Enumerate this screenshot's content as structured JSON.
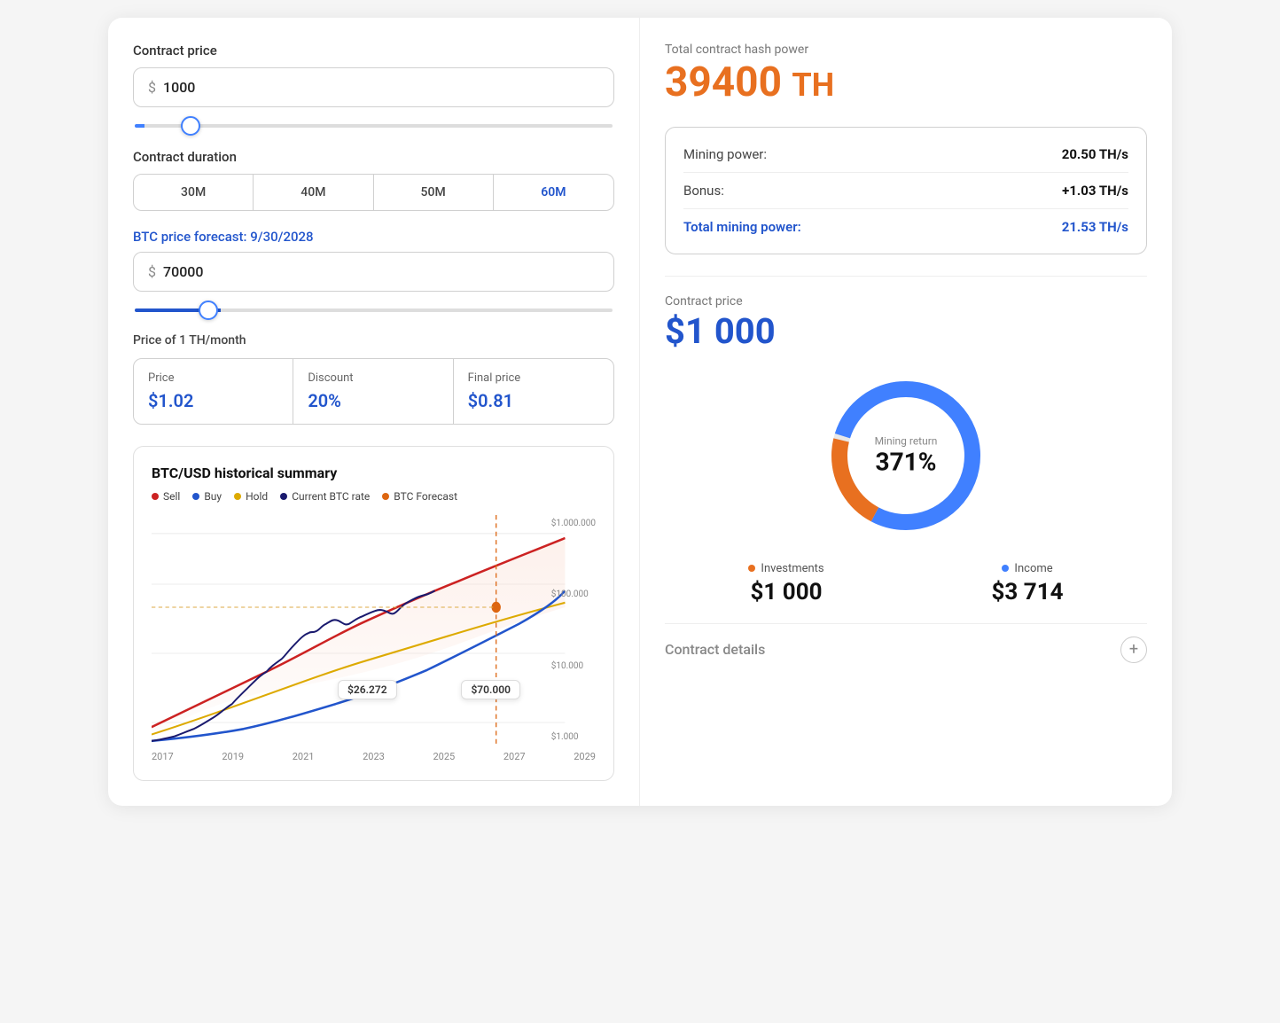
{
  "left": {
    "contract_price_label": "Contract price",
    "contract_price_currency": "$",
    "contract_price_value": "1000",
    "contract_duration_label": "Contract duration",
    "duration_tabs": [
      "30M",
      "40M",
      "50M",
      "60M"
    ],
    "active_tab_index": 3,
    "btc_forecast_label": "BTC price forecast:",
    "btc_forecast_date": "9/30/2028",
    "btc_price_currency": "$",
    "btc_price_value": "70000",
    "price_th_label": "Price of 1 TH/month",
    "price_cells": [
      {
        "label": "Price",
        "value": "$1.02"
      },
      {
        "label": "Discount",
        "value": "20%"
      },
      {
        "label": "Final price",
        "value": "$0.81"
      }
    ],
    "chart": {
      "title": "BTC/USD historical summary",
      "legend": [
        {
          "label": "Sell",
          "color": "#cc2222"
        },
        {
          "label": "Buy",
          "color": "#2255cc"
        },
        {
          "label": "Hold",
          "color": "#ddaa00"
        },
        {
          "label": "Current BTC rate",
          "color": "#1a1a6e"
        },
        {
          "label": "BTC Forecast",
          "color": "#dd6611"
        }
      ],
      "x_labels": [
        "2017",
        "2019",
        "2021",
        "2023",
        "2025",
        "2027",
        "2029"
      ],
      "y_labels": [
        "$1.000.000",
        "$100.000",
        "$10.000",
        "$1.000"
      ],
      "tooltip_left": "$26.272",
      "tooltip_right": "$70.000"
    }
  },
  "right": {
    "hash_power_label": "Total contract hash power",
    "hash_power_value": "39400",
    "hash_power_unit": "TH",
    "mining_power_label": "Mining power:",
    "mining_power_value": "20.50 TH/s",
    "bonus_label": "Bonus:",
    "bonus_value": "+1.03 TH/s",
    "total_mining_label": "Total mining power:",
    "total_mining_value": "21.53 TH/s",
    "contract_price_label": "Contract price",
    "contract_price_value": "$1 000",
    "donut": {
      "center_label": "Mining return",
      "center_value": "371%",
      "investment_pct": 22,
      "income_pct": 78
    },
    "investments_label": "Investments",
    "investments_value": "$1 000",
    "income_label": "Income",
    "income_value": "$3 714",
    "investment_color": "#e87020",
    "income_color": "#4080ff",
    "contract_details_label": "Contract details",
    "contract_details_icon": "+"
  }
}
